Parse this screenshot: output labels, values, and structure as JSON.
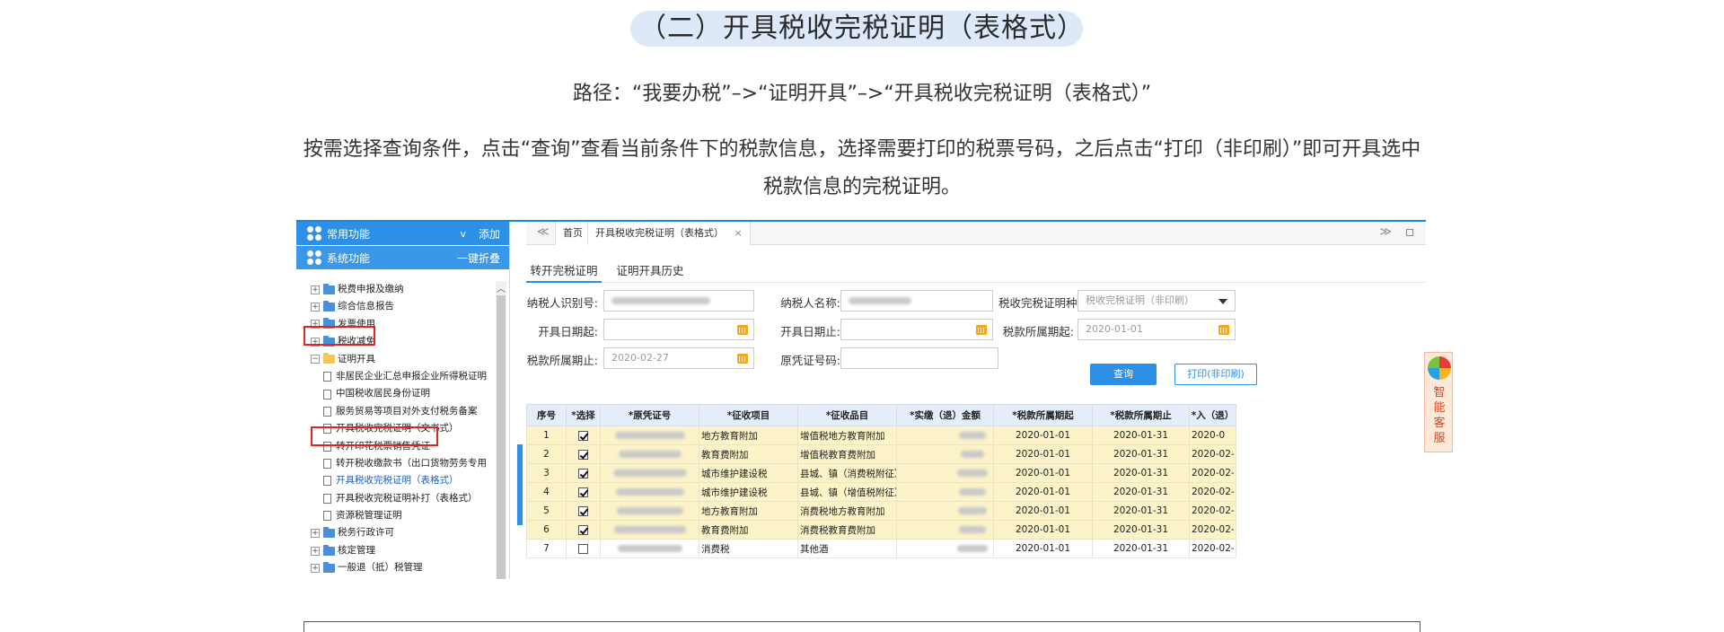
{
  "heading": "（二）开具税收完税证明（表格式）",
  "path": "路径：“我要办税”–>“证明开具”–>“开具税收完税证明（表格式）”",
  "description": "按需选择查询条件，点击“查询”查看当前条件下的税款信息，选择需要打印的税票号码，之后点击“打印（非印刷）”即可开具选中税款信息的完税证明。",
  "sidebar": {
    "common_title": "常用功能",
    "common_action": "添加",
    "common_chevron": "v",
    "system_title": "系统功能",
    "system_action": "一键折叠",
    "tree": [
      {
        "label": "税费申报及缴纳",
        "type": "folder"
      },
      {
        "label": "综合信息报告",
        "type": "folder"
      },
      {
        "label": "发票使用",
        "type": "folder"
      },
      {
        "label": "税收减免",
        "type": "folder"
      },
      {
        "label": "证明开具",
        "type": "folder-open"
      },
      {
        "label": "非居民企业汇总申报企业所得税证明",
        "type": "doc"
      },
      {
        "label": "中国税收居民身份证明",
        "type": "doc"
      },
      {
        "label": "服务贸易等项目对外支付税务备案",
        "type": "doc"
      },
      {
        "label": "开具税收完税证明（文书式）",
        "type": "doc"
      },
      {
        "label": "转开印花税票销售凭证",
        "type": "doc"
      },
      {
        "label": "转开税收缴款书（出口货物劳务专用",
        "type": "doc"
      },
      {
        "label": "开具税收完税证明（表格式）",
        "type": "doc",
        "selected": true
      },
      {
        "label": "开具税收完税证明补打（表格式）",
        "type": "doc"
      },
      {
        "label": "资源税管理证明",
        "type": "doc"
      },
      {
        "label": "税务行政许可",
        "type": "folder"
      },
      {
        "label": "核定管理",
        "type": "folder"
      },
      {
        "label": "一般退（抵）税管理",
        "type": "folder"
      }
    ]
  },
  "topbar": {
    "home_tab": "首页",
    "active_tab": "开具税收完税证明（表格式）",
    "close": "×",
    "nav_left": "≪",
    "nav_right": "≫"
  },
  "subtabs": [
    "转开完税证明",
    "证明开具历史"
  ],
  "form": {
    "taxpayer_id_label": "纳税人识别号:",
    "taxpayer_name_label": "纳税人名称:",
    "cert_type_label": "税收完税证明种...",
    "cert_type_value": "税收完税证明（非印刷）",
    "start_date_from_label": "开具日期起:",
    "start_date_to_label": "开具日期止:",
    "period_from_label": "税款所属期起:",
    "period_from_value": "2020-01-01",
    "period_to_label": "税款所属期止:",
    "period_to_value": "2020-02-27",
    "voucher_no_label": "原凭证号码:",
    "query_button": "查询",
    "print_button": "打印(非印刷)"
  },
  "table": {
    "headers": [
      "序号",
      "*选择",
      "*原凭证号",
      "*征收项目",
      "*征收品目",
      "*实缴（退）金额",
      "*税款所属期起",
      "*税款所属期止",
      "*入（退）"
    ],
    "rows": [
      {
        "no": "1",
        "checked": true,
        "item": "地方教育附加",
        "sub": "增值税地方教育附加",
        "from": "2020-01-01",
        "to": "2020-01-31",
        "entry": "2020-0"
      },
      {
        "no": "2",
        "checked": true,
        "item": "教育费附加",
        "sub": "增值税教育费附加",
        "from": "2020-01-01",
        "to": "2020-01-31",
        "entry": "2020-02-"
      },
      {
        "no": "3",
        "checked": true,
        "item": "城市维护建设税",
        "sub": "县城、镇（消费税附征）",
        "from": "2020-01-01",
        "to": "2020-01-31",
        "entry": "2020-02-"
      },
      {
        "no": "4",
        "checked": true,
        "item": "城市维护建设税",
        "sub": "县城、镇（增值税附征）",
        "from": "2020-01-01",
        "to": "2020-01-31",
        "entry": "2020-02-"
      },
      {
        "no": "5",
        "checked": true,
        "item": "地方教育附加",
        "sub": "消费税地方教育附加",
        "from": "2020-01-01",
        "to": "2020-01-31",
        "entry": "2020-02-"
      },
      {
        "no": "6",
        "checked": true,
        "item": "教育费附加",
        "sub": "消费税教育费附加",
        "from": "2020-01-01",
        "to": "2020-01-31",
        "entry": "2020-02-"
      },
      {
        "no": "7",
        "checked": false,
        "item": "消费税",
        "sub": "其他酒",
        "from": "2020-01-01",
        "to": "2020-01-31",
        "entry": "2020-02-"
      }
    ]
  },
  "kefu": {
    "label": "智能客服"
  },
  "colors": {
    "accent": "#2d8fe5",
    "highlight_row": "#fcf3c8",
    "red_box": "#e02424"
  }
}
